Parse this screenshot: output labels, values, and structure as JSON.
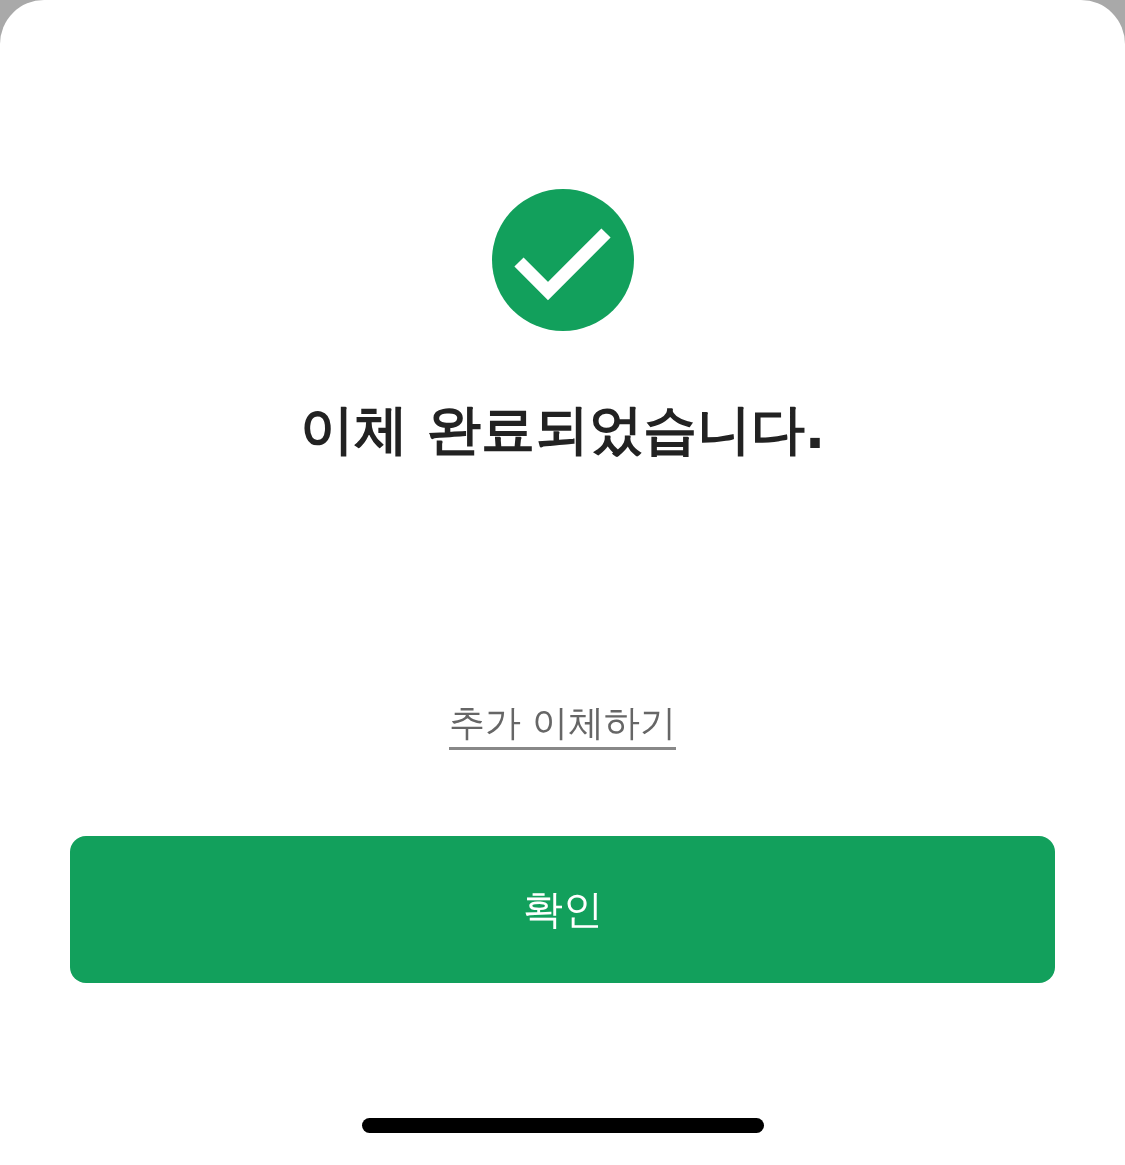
{
  "title": "이체 완료되었습니다.",
  "link": "추가 이체하기",
  "confirm_button": "확인"
}
